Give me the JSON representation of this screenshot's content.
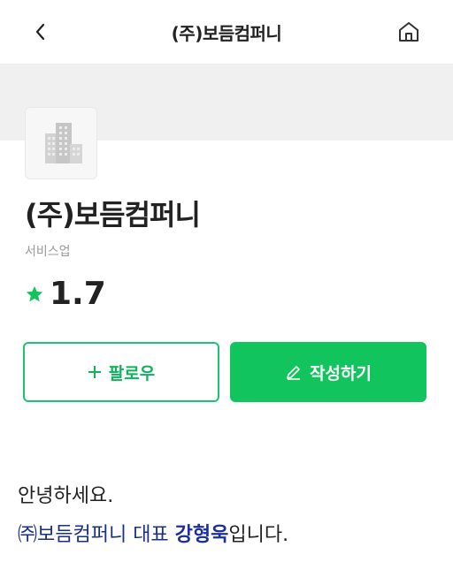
{
  "header": {
    "title": "(주)보듬컴퍼니",
    "back_icon": "chevron-left-icon",
    "home_icon": "home-icon"
  },
  "company": {
    "name": "(주)보듬컴퍼니",
    "industry": "서비스업",
    "rating": "1.7",
    "logo_icon": "building-icon"
  },
  "actions": {
    "follow_label": "팔로우",
    "write_label": "작성하기"
  },
  "intro": {
    "line1": "안녕하세요.",
    "line2_prefix": "㈜보듬컴퍼니 대표 ",
    "ceo_name": "강형욱",
    "line2_suffix": "입니다."
  },
  "colors": {
    "accent": "#12c45e",
    "star": "#12c45e",
    "ceo_name": "#1a2fa0"
  }
}
